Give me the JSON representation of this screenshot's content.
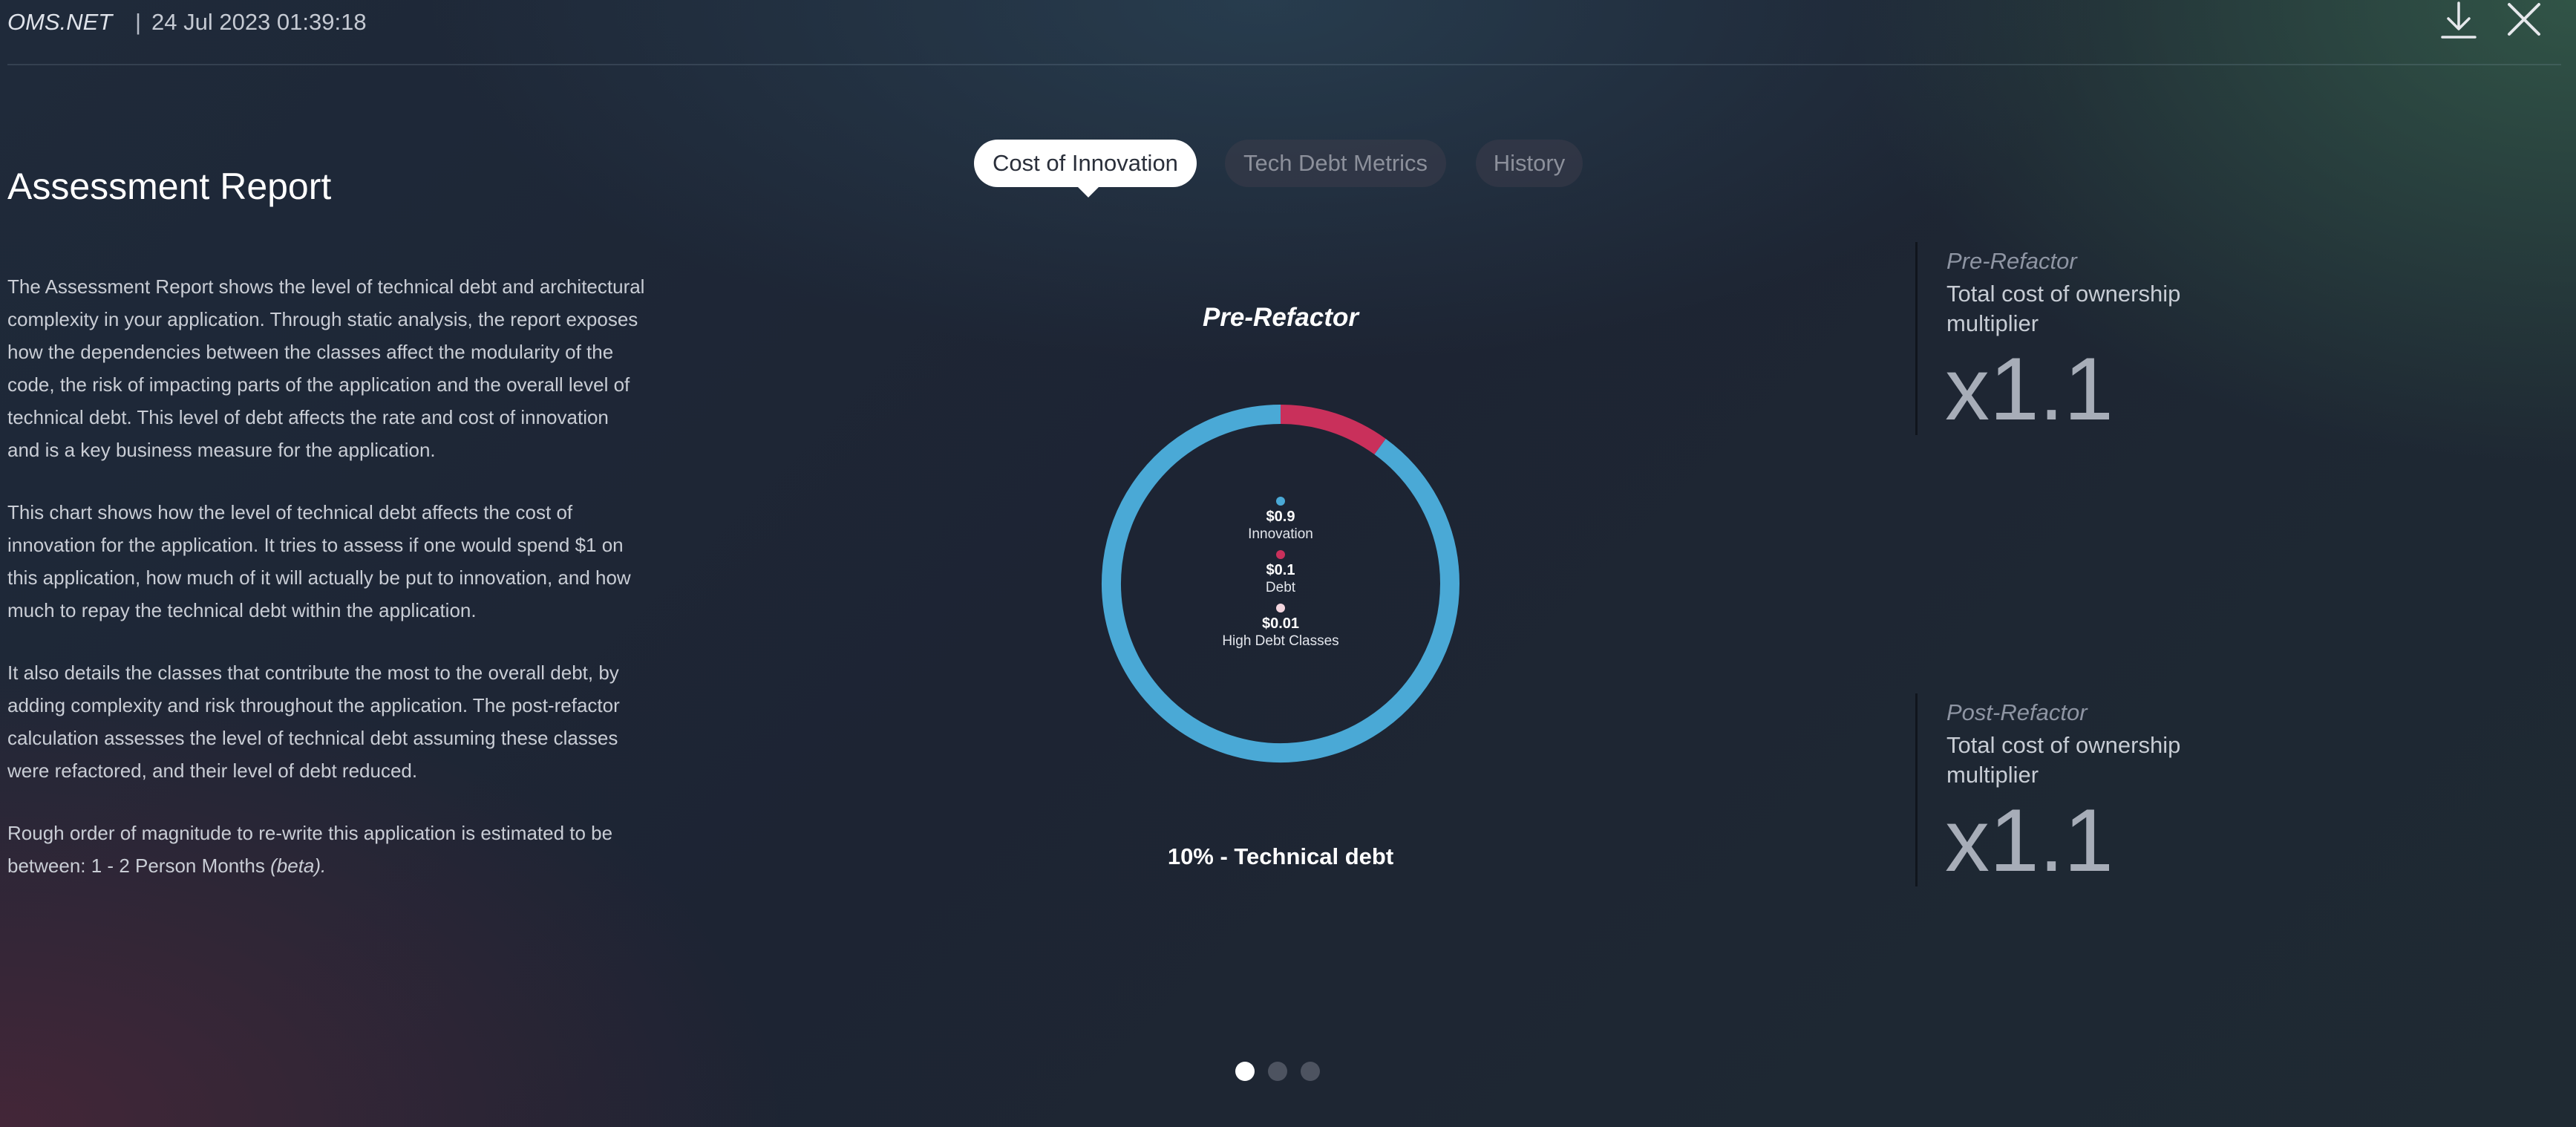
{
  "header": {
    "brand": "OMS.NET",
    "separator": "|",
    "timestamp": "24 Jul 2023 01:39:18",
    "icons": [
      "download-icon",
      "close-icon"
    ]
  },
  "report": {
    "title": "Assessment Report",
    "paragraphs": [
      "The Assessment Report shows the level of technical debt and architectural complexity in your application. Through static analysis, the report exposes how the dependencies between the classes affect the modularity of the code, the risk of impacting parts of the application and the overall level of technical debt. This level of debt affects the rate and cost of innovation and is a key business measure for the application.",
      "This chart shows how the level of technical debt affects the cost of innovation for the application. It tries to assess if one would spend $1 on this application, how much of it will actually be put to innovation, and how much to repay the technical debt within the application.",
      "It also details the classes that contribute the most to the overall debt, by adding complexity and risk throughout the application. The post-refactor calculation assesses the level of technical debt assuming these classes were refactored, and their level of debt reduced."
    ],
    "rom_text": "Rough order of magnitude to re-write this application is estimated to be between: 1 - 2 Person Months",
    "rom_beta": "(beta)."
  },
  "tabs": [
    {
      "label": "Cost of Innovation",
      "active": true
    },
    {
      "label": "Tech Debt Metrics",
      "active": false
    },
    {
      "label": "History",
      "active": false
    }
  ],
  "chart_data": {
    "type": "pie",
    "title": "Pre-Refactor",
    "footer": "10% - Technical debt",
    "slices": [
      {
        "label": "Innovation",
        "value": 0.9,
        "value_label": "$0.9",
        "color": "#4aa9d6"
      },
      {
        "label": "Debt",
        "value": 0.1,
        "value_label": "$0.1",
        "color": "#c9305b"
      },
      {
        "label": "High Debt Classes",
        "value": 0.01,
        "value_label": "$0.01",
        "color": "#f3d6df"
      }
    ]
  },
  "metrics": {
    "pre": {
      "label": "Pre-Refactor",
      "sub": "Total cost of ownership multiplier",
      "value": "x1.1"
    },
    "post": {
      "label": "Post-Refactor",
      "sub": "Total cost of ownership multiplier",
      "value": "x1.1"
    }
  },
  "pagination": {
    "current": 1,
    "total": 3
  },
  "colors": {
    "accent_blue": "#4aa9d6",
    "accent_red": "#c9305b",
    "active_dot": "#ffffff",
    "inactive_dot": "#4d5360"
  }
}
